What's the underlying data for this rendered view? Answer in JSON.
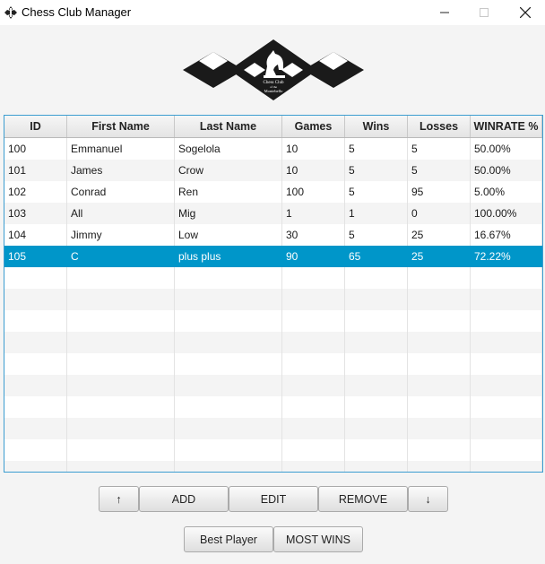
{
  "window": {
    "title": "Chess Club Manager",
    "controls": {
      "minimize": "minimize-icon",
      "maximize": "maximize-icon",
      "close": "close-icon"
    }
  },
  "logo": {
    "icon": "knight-icon",
    "line1": "Chess Club",
    "line2": "of the",
    "line3": "Montebello"
  },
  "table": {
    "columns": [
      "ID",
      "First Name",
      "Last Name",
      "Games",
      "Wins",
      "Losses",
      "WINRATE %"
    ],
    "rows": [
      [
        "100",
        "Emmanuel",
        "Sogelola",
        "10",
        "5",
        "5",
        "50.00%"
      ],
      [
        "101",
        "James",
        "Crow",
        "10",
        "5",
        "5",
        "50.00%"
      ],
      [
        "102",
        "Conrad",
        "Ren",
        "100",
        "5",
        "95",
        "5.00%"
      ],
      [
        "103",
        "All",
        "Mig",
        "1",
        "1",
        "0",
        "100.00%"
      ],
      [
        "104",
        "Jimmy",
        "Low",
        "30",
        "5",
        "25",
        "16.67%"
      ],
      [
        "105",
        "C",
        "plus plus",
        "90",
        "65",
        "25",
        "72.22%"
      ]
    ],
    "selected_row": 5,
    "accent": "#0096c9"
  },
  "actions": {
    "move_up": "↑",
    "add": "ADD",
    "edit": "EDIT",
    "remove": "REMOVE",
    "move_down": "↓",
    "best_player": "Best Player",
    "most_wins": "MOST WINS"
  }
}
